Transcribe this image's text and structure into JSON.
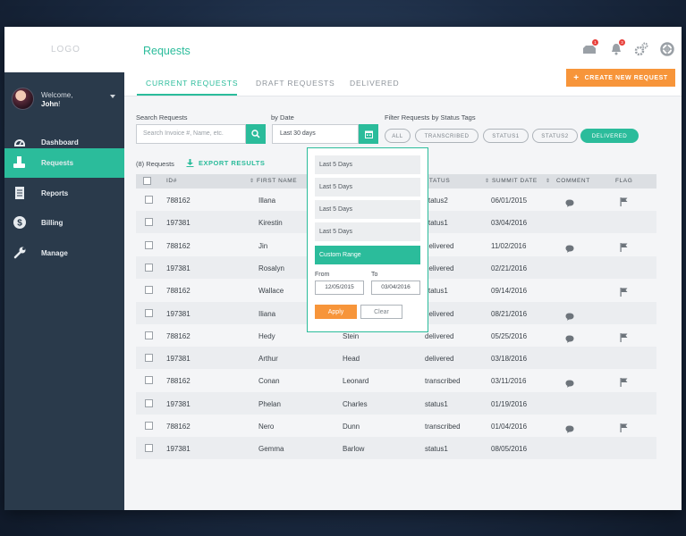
{
  "brand": {
    "logo": "LOGO",
    "accent": "#2bbc9b",
    "orange": "#f7953a"
  },
  "user": {
    "greeting": "Welcome,",
    "name": "John",
    "punct": "!"
  },
  "sidebar": {
    "items": [
      {
        "label": "Dashboard",
        "icon": "speedometer-icon"
      },
      {
        "label": "Requests",
        "icon": "requests-icon"
      },
      {
        "label": "Reports",
        "icon": "reports-icon"
      },
      {
        "label": "Billing",
        "icon": "dollar-icon"
      },
      {
        "label": "Manage",
        "icon": "wrench-icon"
      }
    ]
  },
  "header": {
    "title": "Requests",
    "notifications": {
      "inbox_count": "1",
      "bell_count": "3"
    },
    "tabs": [
      "CURRENT REQUESTS",
      "DRAFT REQUESTS",
      "DELIVERED"
    ],
    "create_button": "CREATE NEW REQUEST"
  },
  "filters": {
    "search_label": "Search Requests",
    "search_placeholder": "Search Invoice #, Name, etc.",
    "date_label": "by Date",
    "date_value": "Last 30 days",
    "status_label": "Filter Requests by Status Tags",
    "status_tags": [
      "ALL",
      "TRANSCRIBED",
      "STATUS1",
      "STATUS2",
      "DELIVERED"
    ],
    "active_tag": "DELIVERED"
  },
  "results": {
    "count": "(8) Requests",
    "export": "EXPORT RESULTS"
  },
  "table": {
    "headers": [
      "ID#",
      "FIRST NAME",
      "",
      "STATUS",
      "SUMMIT DATE",
      "COMMENT",
      "FLAG"
    ],
    "rows": [
      {
        "id": "788162",
        "first": "Illana",
        "last": "",
        "status": "status2",
        "date": "06/01/2015",
        "comment": true,
        "flag": true
      },
      {
        "id": "197381",
        "first": "Kirestin",
        "last": "",
        "status": "status1",
        "date": "03/04/2016",
        "comment": false,
        "flag": false
      },
      {
        "id": "788162",
        "first": "Jin",
        "last": "",
        "status": "delivered",
        "date": "11/02/2016",
        "comment": true,
        "flag": true
      },
      {
        "id": "197381",
        "first": "Rosalyn",
        "last": "",
        "status": "delivered",
        "date": "02/21/2016",
        "comment": false,
        "flag": false
      },
      {
        "id": "788162",
        "first": "Wallace",
        "last": "",
        "status": "status1",
        "date": "09/14/2016",
        "comment": false,
        "flag": true
      },
      {
        "id": "197381",
        "first": "Iliana",
        "last": "",
        "status": "delivered",
        "date": "08/21/2016",
        "comment": true,
        "flag": false
      },
      {
        "id": "788162",
        "first": "Hedy",
        "last": "Stein",
        "status": "delivered",
        "date": "05/25/2016",
        "comment": true,
        "flag": true
      },
      {
        "id": "197381",
        "first": "Arthur",
        "last": "Head",
        "status": "delivered",
        "date": "03/18/2016",
        "comment": false,
        "flag": false
      },
      {
        "id": "788162",
        "first": "Conan",
        "last": "Leonard",
        "status": "transcribed",
        "date": "03/11/2016",
        "comment": true,
        "flag": true
      },
      {
        "id": "197381",
        "first": "Phelan",
        "last": "Charles",
        "status": "status1",
        "date": "01/19/2016",
        "comment": false,
        "flag": false
      },
      {
        "id": "788162",
        "first": "Nero",
        "last": "Dunn",
        "status": "transcribed",
        "date": "01/04/2016",
        "comment": true,
        "flag": true
      },
      {
        "id": "197381",
        "first": "Gemma",
        "last": "Barlow",
        "status": "status1",
        "date": "08/05/2016",
        "comment": false,
        "flag": false
      }
    ]
  },
  "date_dropdown": {
    "options": [
      "Last 5 Days",
      "Last 5 Days",
      "Last 5 Days",
      "Last 5 Days",
      "Custom Range"
    ],
    "from_label": "From",
    "to_label": "To",
    "from_value": "12/05/2015",
    "to_value": "03/04/2016",
    "apply": "Apply",
    "clear": "Clear"
  }
}
